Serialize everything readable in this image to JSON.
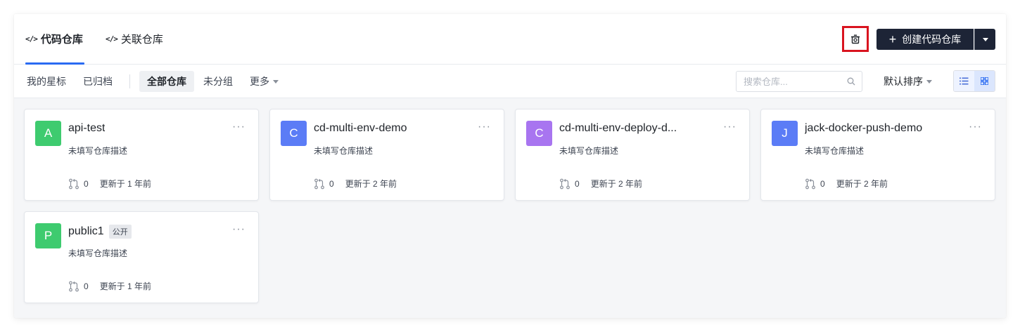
{
  "tabs": [
    {
      "label": "代码仓库",
      "active": true
    },
    {
      "label": "关联仓库",
      "active": false
    }
  ],
  "header": {
    "create_label": "创建代码仓库"
  },
  "filters": {
    "starred": "我的星标",
    "archived": "已归档",
    "all": "全部仓库",
    "ungrouped": "未分组",
    "more": "更多"
  },
  "search": {
    "placeholder": "搜索仓库..."
  },
  "sort": {
    "label": "默认排序"
  },
  "colors": {
    "accent": "#2a6bf2",
    "dark_button": "#1d2436",
    "highlight_border": "#d9141f",
    "avatar_green": "#3ecb6f",
    "avatar_blue": "#5b7cf6",
    "avatar_purple": "#a875f0"
  },
  "repos": [
    {
      "initial": "A",
      "name": "api-test",
      "desc": "未填写仓库描述",
      "mr_count": "0",
      "updated": "更新于 1 年前",
      "color": "#3ecb6f",
      "badge": ""
    },
    {
      "initial": "C",
      "name": "cd-multi-env-demo",
      "desc": "未填写仓库描述",
      "mr_count": "0",
      "updated": "更新于 2 年前",
      "color": "#5b7cf6",
      "badge": ""
    },
    {
      "initial": "C",
      "name": "cd-multi-env-deploy-d...",
      "desc": "未填写仓库描述",
      "mr_count": "0",
      "updated": "更新于 2 年前",
      "color": "#a875f0",
      "badge": ""
    },
    {
      "initial": "J",
      "name": "jack-docker-push-demo",
      "desc": "未填写仓库描述",
      "mr_count": "0",
      "updated": "更新于 2 年前",
      "color": "#5b7cf6",
      "badge": ""
    },
    {
      "initial": "P",
      "name": "public1",
      "desc": "未填写仓库描述",
      "mr_count": "0",
      "updated": "更新于 1 年前",
      "color": "#3ecb6f",
      "badge": "公开"
    }
  ]
}
